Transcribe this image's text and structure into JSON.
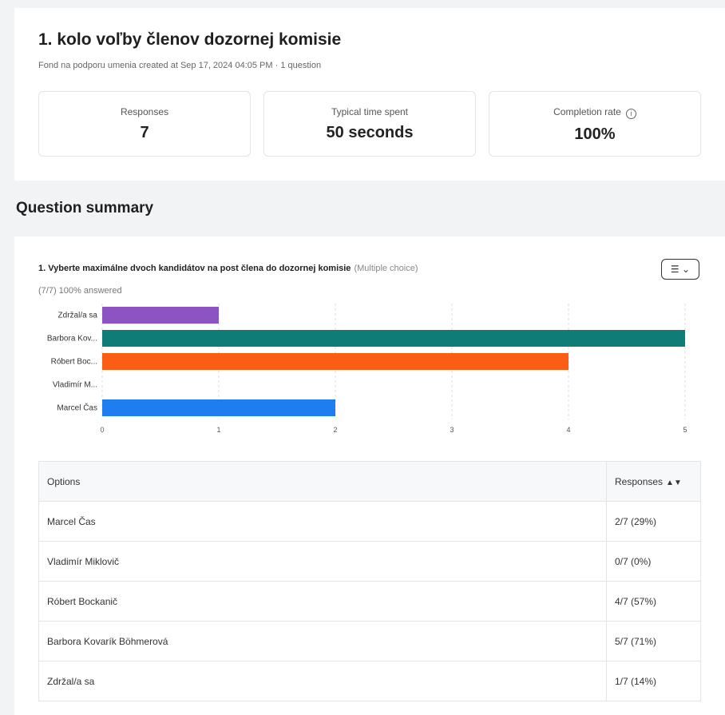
{
  "survey": {
    "title": "1. kolo voľby členov dozornej komisie",
    "meta": "Fond na podporu umenia created at Sep 17, 2024 04:05 PM · 1 question"
  },
  "stats": [
    {
      "label": "Responses",
      "value": "7"
    },
    {
      "label": "Typical time spent",
      "value": "50 seconds"
    },
    {
      "label": "Completion rate",
      "value": "100%",
      "icon": "info-icon"
    }
  ],
  "section_title": "Question summary",
  "question": {
    "title": "1. Vyberte maximálne dvoch kandidátov na post člena do dozornej komisie",
    "type": "(Multiple choice)",
    "answered": "(7/7) 100% answered",
    "chart_button_icon": "chart-type-icon"
  },
  "chart_data": {
    "type": "bar",
    "orientation": "horizontal",
    "categories": [
      "Zdržal/a sa",
      "Barbora Kov...",
      "Róbert Boc...",
      "Vladimír M...",
      "Marcel Čas"
    ],
    "values": [
      1,
      5,
      4,
      0,
      2
    ],
    "colors": [
      "#8e53c2",
      "#0f7c78",
      "#fb5d14",
      "#7a9cc6",
      "#1e7ef0"
    ],
    "xlim": [
      0,
      5
    ],
    "ticks": [
      "0",
      "1",
      "2",
      "3",
      "4",
      "5"
    ],
    "grid": true
  },
  "table": {
    "headers": [
      "Options",
      "Responses"
    ],
    "rows": [
      [
        "Marcel Čas",
        "2/7 (29%)"
      ],
      [
        "Vladimír Miklovič",
        "0/7 (0%)"
      ],
      [
        "Róbert Bockanič",
        "4/7 (57%)"
      ],
      [
        "Barbora Kovarík Böhmerová",
        "5/7 (71%)"
      ],
      [
        "Zdržal/a sa",
        "1/7 (14%)"
      ]
    ]
  }
}
